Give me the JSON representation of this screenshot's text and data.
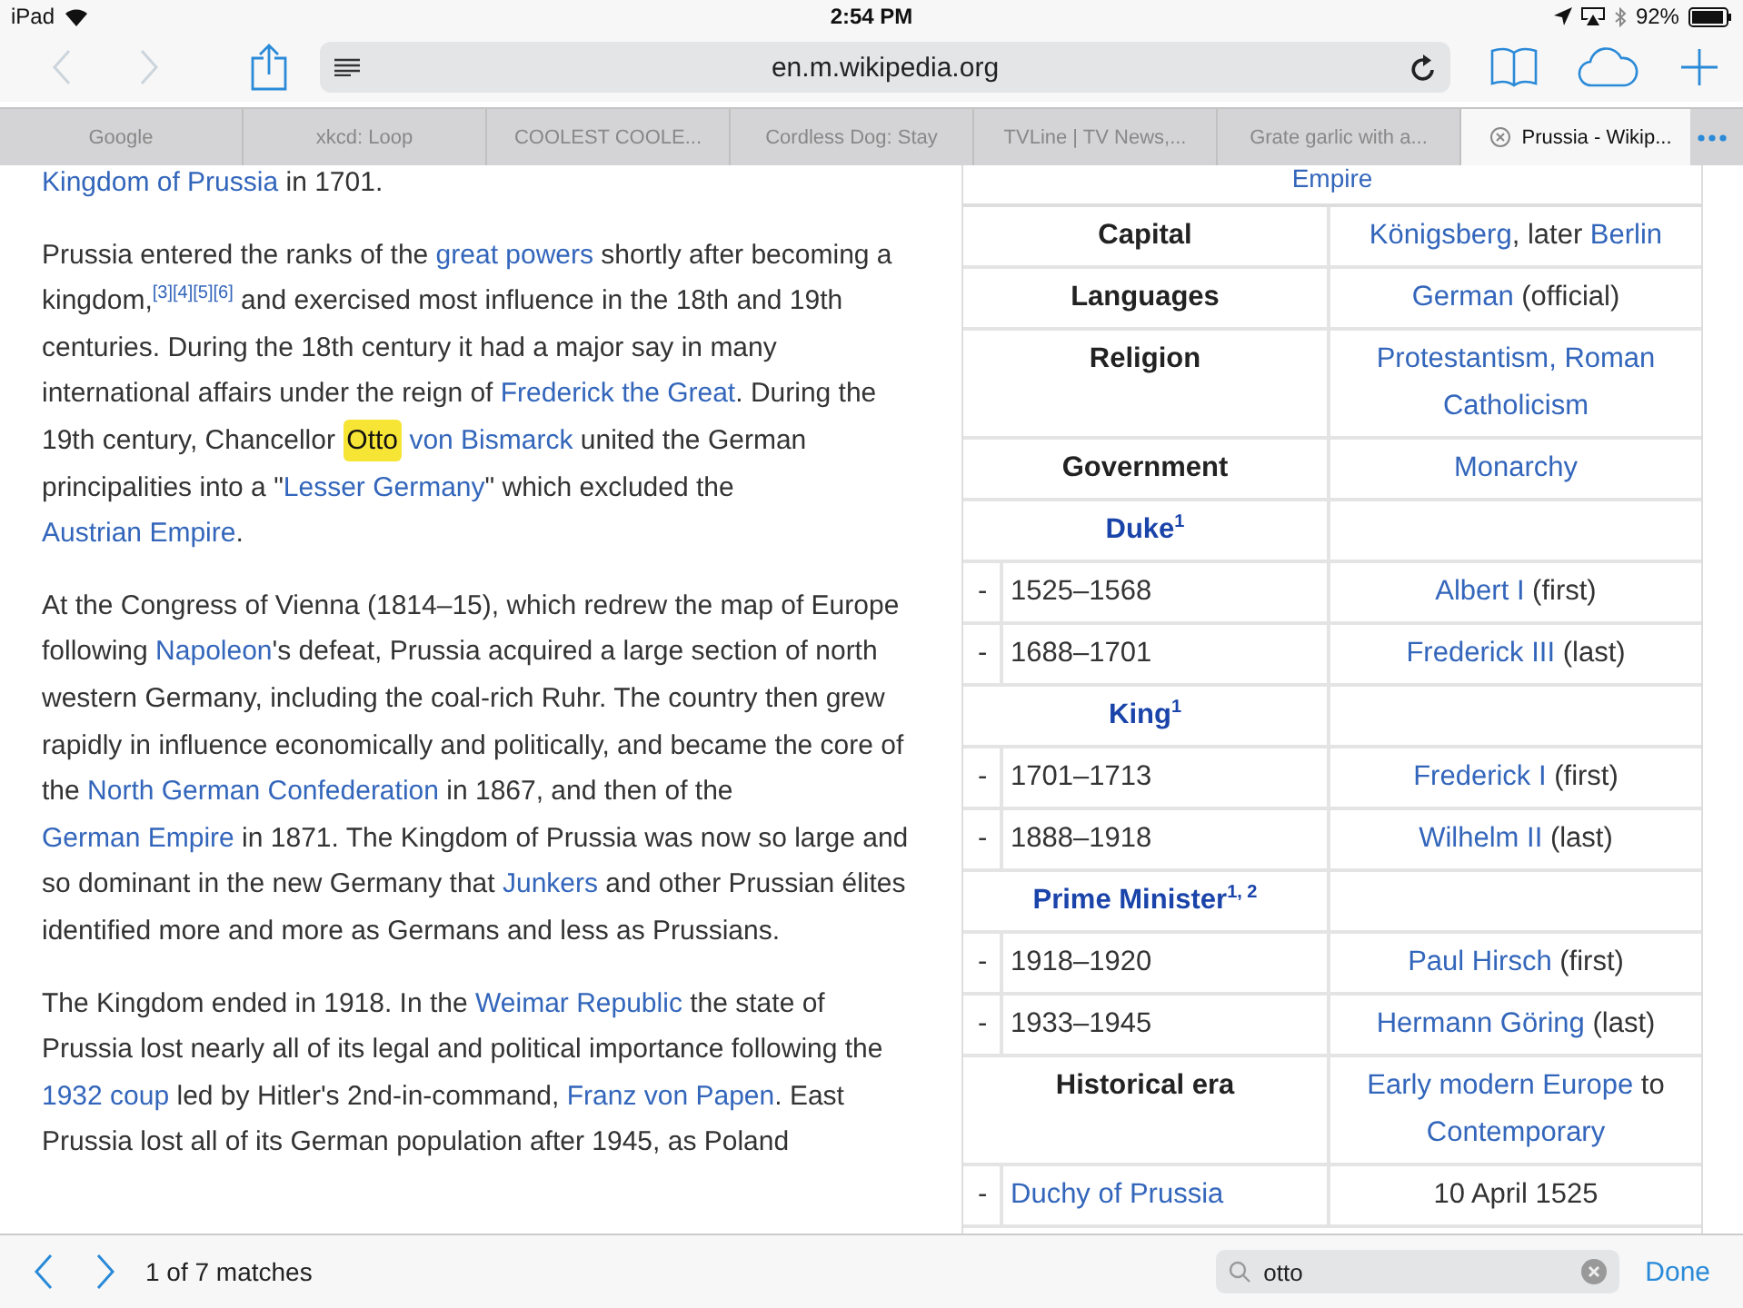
{
  "status_bar": {
    "device": "iPad",
    "time": "2:54 PM",
    "battery": "92%"
  },
  "toolbar": {
    "back": {
      "disabled": true
    },
    "forward": {
      "disabled": true
    },
    "url": "en.m.wikipedia.org"
  },
  "tabs": [
    {
      "label": "Google",
      "selected": false
    },
    {
      "label": "xkcd: Loop",
      "selected": false
    },
    {
      "label": "COOLEST COOLE...",
      "selected": false
    },
    {
      "label": "Cordless Dog: Stay",
      "selected": false
    },
    {
      "label": "TVLine | TV News,...",
      "selected": false
    },
    {
      "label": "Grate garlic with a...",
      "selected": false
    },
    {
      "label": "Prussia - Wikip...",
      "selected": true
    }
  ],
  "article": {
    "paragraphs": [
      [
        {
          "kind": "link",
          "text": "Kingdom of Prussia"
        },
        {
          "kind": "text",
          "text": " in 1701."
        }
      ],
      [
        {
          "kind": "text",
          "text": "Prussia entered the ranks of the "
        },
        {
          "kind": "link",
          "text": "great powers"
        },
        {
          "kind": "text",
          "text": " shortly after becoming a kingdom,"
        },
        {
          "kind": "ref",
          "text": "[3][4][5][6]"
        },
        {
          "kind": "text",
          "text": " and exercised most influence in the 18th and 19th centuries. During the 18th century it had a major say in many international affairs under the reign of "
        },
        {
          "kind": "link",
          "text": "Frederick the Great"
        },
        {
          "kind": "text",
          "text": ". During the 19th century, Chancellor "
        },
        {
          "kind": "match",
          "text": "Otto"
        },
        {
          "kind": "link",
          "text": "von Bismarck"
        },
        {
          "kind": "text",
          "text": " united the German principalities into a \""
        },
        {
          "kind": "link",
          "text": "Lesser Germany"
        },
        {
          "kind": "text",
          "text": "\" which excluded the "
        },
        {
          "kind": "link",
          "text": "Austrian Empire"
        },
        {
          "kind": "text",
          "text": "."
        }
      ],
      [
        {
          "kind": "text",
          "text": "At the Congress of Vienna (1814–15), which redrew the map of Europe following "
        },
        {
          "kind": "link",
          "text": "Napoleon"
        },
        {
          "kind": "text",
          "text": "'s defeat, Prussia acquired a large section of north western Germany, including the coal-rich Ruhr. The country then grew rapidly in influence economically and politically, and became the core of the "
        },
        {
          "kind": "link",
          "text": "North German Confederation"
        },
        {
          "kind": "text",
          "text": " in 1867, and then of the "
        },
        {
          "kind": "link",
          "text": "German Empire"
        },
        {
          "kind": "text",
          "text": " in 1871. The Kingdom of Prussia was now so large and so dominant in the new Germany that "
        },
        {
          "kind": "link",
          "text": "Junkers"
        },
        {
          "kind": "text",
          "text": " and other Prussian élites identified more and more as Germans and less as Prussians."
        }
      ],
      [
        {
          "kind": "text",
          "text": "The Kingdom ended in 1918. In the "
        },
        {
          "kind": "link",
          "text": "Weimar Republic"
        },
        {
          "kind": "text",
          "text": " the state of Prussia lost nearly all of its legal and political importance following the "
        },
        {
          "kind": "link",
          "text": "1932 coup"
        },
        {
          "kind": "text",
          "text": " led by Hitler's 2nd-in-command, "
        },
        {
          "kind": "link",
          "text": "Franz von Papen"
        },
        {
          "kind": "text",
          "text": ". East Prussia lost all of its German population after 1945, as Poland"
        }
      ]
    ]
  },
  "infobox": {
    "top_link": "Empire",
    "rows": [
      {
        "kind": "field",
        "label": "Capital",
        "value": [
          {
            "kind": "link",
            "text": "Königsberg"
          },
          {
            "kind": "text",
            "text": ", later "
          },
          {
            "kind": "link",
            "text": "Berlin"
          }
        ]
      },
      {
        "kind": "field",
        "label": "Languages",
        "value": [
          {
            "kind": "link",
            "text": "German"
          },
          {
            "kind": "text",
            "text": " (official)"
          }
        ]
      },
      {
        "kind": "field",
        "label": "Religion",
        "value": [
          {
            "kind": "link",
            "text": "Protestantism, Roman Catholicism"
          }
        ]
      },
      {
        "kind": "field",
        "label": "Government",
        "value": [
          {
            "kind": "link",
            "text": "Monarchy"
          }
        ]
      },
      {
        "kind": "section",
        "label": "Duke",
        "note": "1"
      },
      {
        "kind": "sub",
        "marker": "-",
        "label": "1525–1568",
        "value": [
          {
            "kind": "link",
            "text": "Albert I"
          },
          {
            "kind": "text",
            "text": " (first)"
          }
        ]
      },
      {
        "kind": "sub",
        "marker": "-",
        "label": "1688–1701",
        "value": [
          {
            "kind": "link",
            "text": "Frederick III"
          },
          {
            "kind": "text",
            "text": " (last)"
          }
        ]
      },
      {
        "kind": "section",
        "label": "King",
        "note": "1"
      },
      {
        "kind": "sub",
        "marker": "-",
        "label": "1701–1713",
        "value": [
          {
            "kind": "link",
            "text": "Frederick I"
          },
          {
            "kind": "text",
            "text": " (first)"
          }
        ]
      },
      {
        "kind": "sub",
        "marker": "-",
        "label": "1888–1918",
        "value": [
          {
            "kind": "link",
            "text": "Wilhelm II"
          },
          {
            "kind": "text",
            "text": " (last)"
          }
        ]
      },
      {
        "kind": "section",
        "label": "Prime Minister",
        "note": "1, 2"
      },
      {
        "kind": "sub",
        "marker": "-",
        "label": "1918–1920",
        "value": [
          {
            "kind": "link",
            "text": "Paul Hirsch"
          },
          {
            "kind": "text",
            "text": " (first)"
          }
        ]
      },
      {
        "kind": "sub",
        "marker": "-",
        "label": "1933–1945",
        "value": [
          {
            "kind": "link",
            "text": "Hermann Göring"
          },
          {
            "kind": "text",
            "text": " (last)"
          }
        ]
      },
      {
        "kind": "field",
        "label": "Historical era",
        "value": [
          {
            "kind": "link",
            "text": "Early modern Europe"
          },
          {
            "kind": "text",
            "text": " to "
          },
          {
            "kind": "link",
            "text": "Contemporary"
          }
        ]
      },
      {
        "kind": "sublink",
        "marker": "-",
        "label": "Duchy of Prussia",
        "value": [
          {
            "kind": "text",
            "text": "10 April 1525"
          }
        ]
      }
    ]
  },
  "find_bar": {
    "matches": "1 of 7 matches",
    "search": {
      "value": "otto"
    },
    "done": "Done"
  }
}
